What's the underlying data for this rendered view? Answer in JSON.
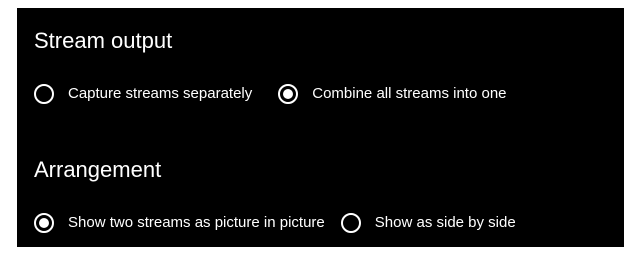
{
  "stream_output": {
    "heading": "Stream output",
    "options": [
      {
        "label": "Capture streams separately",
        "selected": false
      },
      {
        "label": "Combine all streams into one",
        "selected": true
      }
    ]
  },
  "arrangement": {
    "heading": "Arrangement",
    "options": [
      {
        "label": "Show two streams as picture in picture",
        "selected": true
      },
      {
        "label": "Show as side by side",
        "selected": false
      }
    ]
  },
  "colors": {
    "background": "#000000",
    "foreground": "#ffffff"
  }
}
